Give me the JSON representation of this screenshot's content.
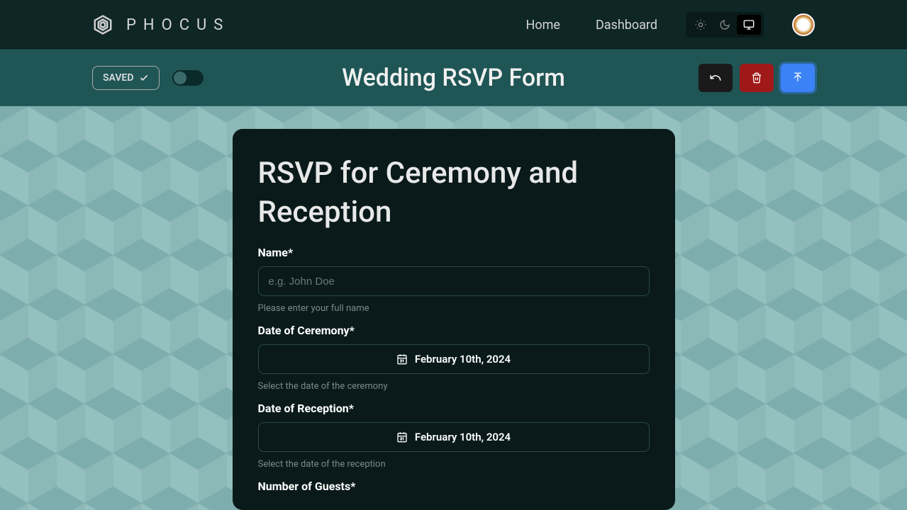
{
  "brand": {
    "name": "PHOCUS"
  },
  "nav": {
    "home": "Home",
    "dashboard": "Dashboard"
  },
  "subbar": {
    "saved": "SAVED",
    "title": "Wedding RSVP Form"
  },
  "form": {
    "heading": "RSVP for Ceremony and Reception",
    "fields": {
      "name": {
        "label": "Name*",
        "placeholder": "e.g. John Doe",
        "help": "Please enter your full name"
      },
      "ceremony": {
        "label": "Date of Ceremony*",
        "value": "February 10th, 2024",
        "help": "Select the date of the ceremony"
      },
      "reception": {
        "label": "Date of Reception*",
        "value": "February 10th, 2024",
        "help": "Select the date of the reception"
      },
      "guests": {
        "label": "Number of Guests*"
      }
    }
  }
}
